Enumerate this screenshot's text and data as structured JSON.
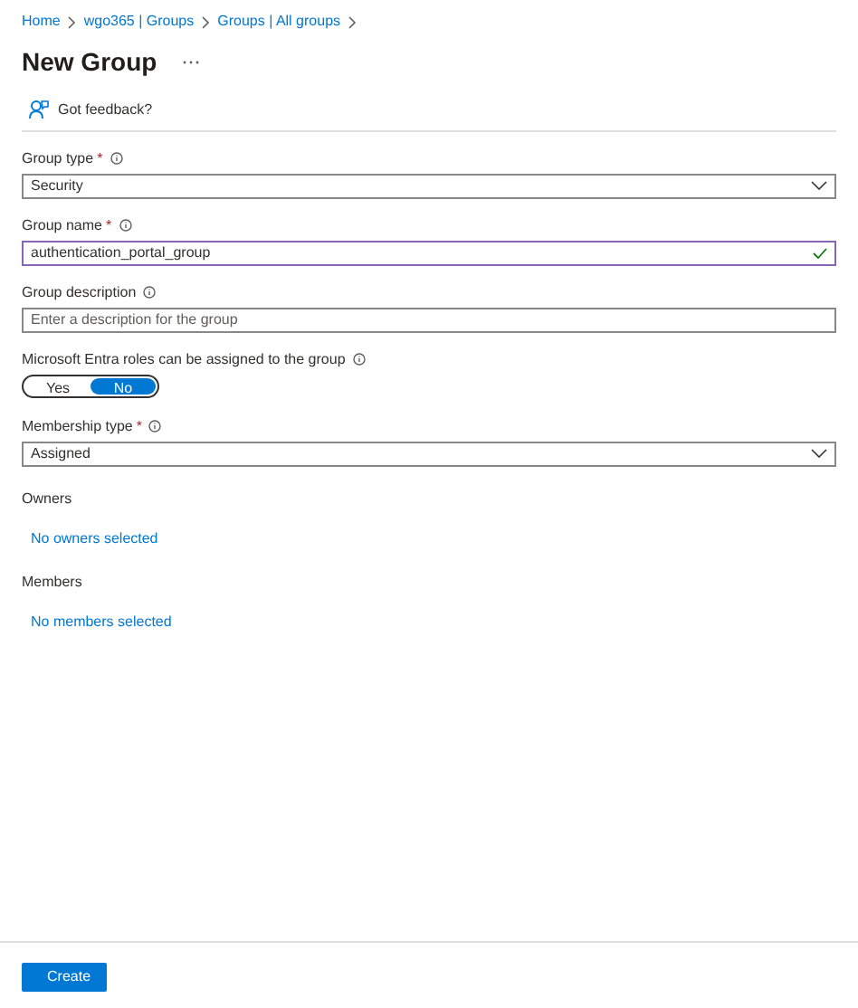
{
  "breadcrumb": [
    {
      "label": "Home"
    },
    {
      "label": "wgo365 | Groups"
    },
    {
      "label": "Groups | All groups"
    }
  ],
  "title": "New Group",
  "feedback": {
    "label": "Got feedback?"
  },
  "fields": [
    {
      "kind": "dropdown",
      "label": "Group type",
      "required_mark": "*",
      "info": true,
      "value": "Security"
    },
    {
      "kind": "text",
      "label": "Group name",
      "required_mark": "*",
      "info": true,
      "value": "authentication_portal_group",
      "valid": true
    },
    {
      "kind": "text",
      "label": "Group description",
      "info": true,
      "placeholder": "Enter a description for the group"
    },
    {
      "kind": "toggle",
      "label": "Microsoft Entra roles can be assigned to the group",
      "info": true,
      "options": [
        {
          "label": "Yes",
          "selected": false
        },
        {
          "label": "No",
          "selected": true
        }
      ]
    },
    {
      "kind": "dropdown",
      "label": "Membership type",
      "required_mark": "*",
      "info": true,
      "value": "Assigned"
    },
    {
      "kind": "picker",
      "label": "Owners",
      "info": false,
      "link": "No owners selected"
    },
    {
      "kind": "picker",
      "label": "Members",
      "info": false,
      "link": "No members selected"
    }
  ],
  "footer": {
    "button": "Create"
  }
}
